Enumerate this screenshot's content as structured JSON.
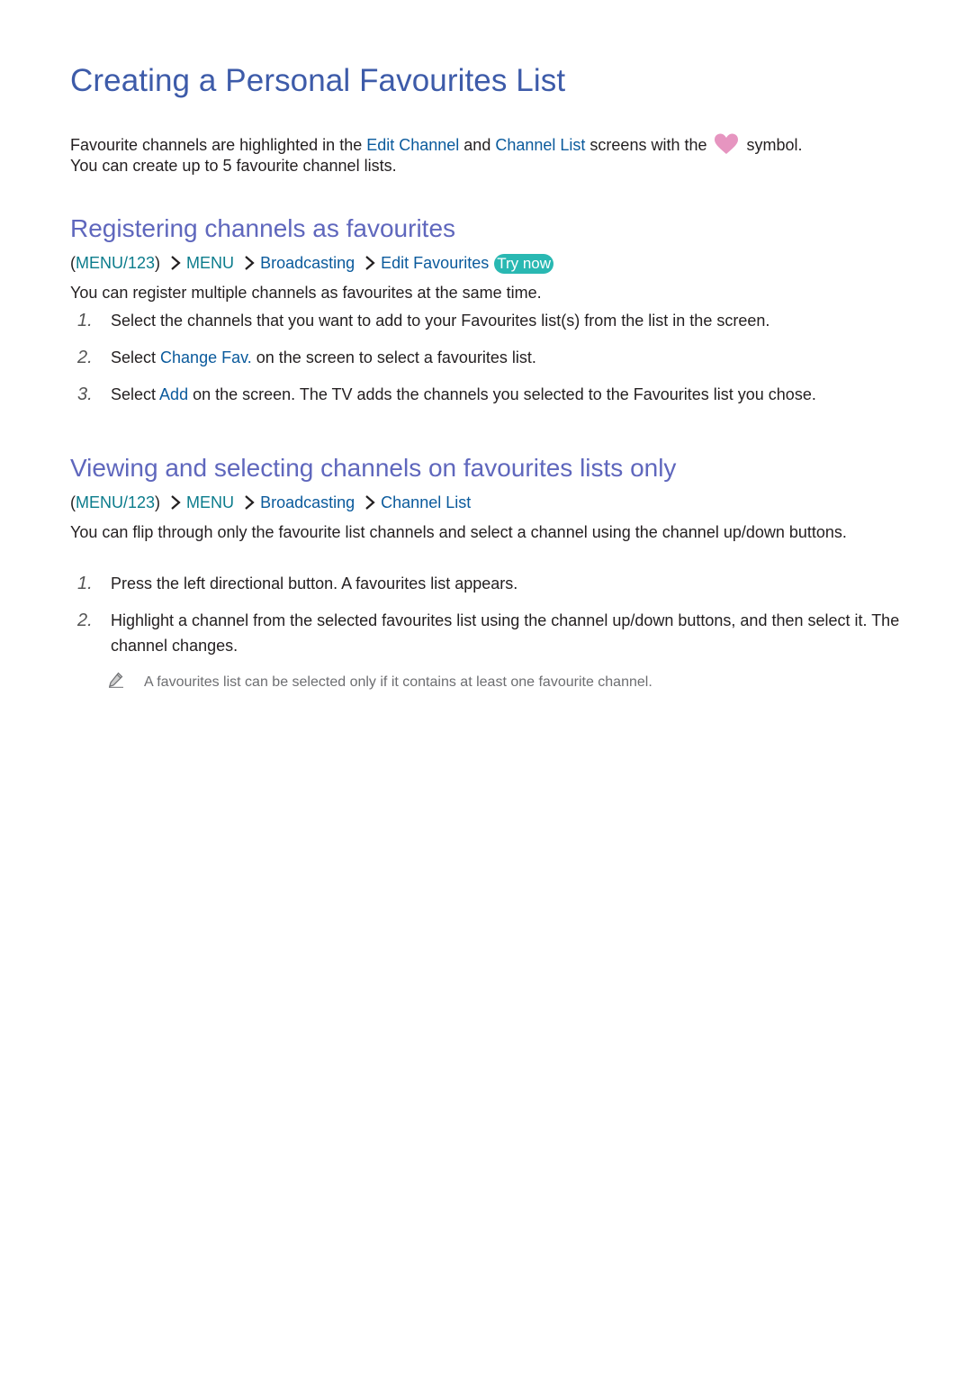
{
  "title": "Creating a Personal Favourites List",
  "intro": {
    "part1": "Favourite channels are highlighted in the ",
    "link1": "Edit Channel",
    "part2": " and ",
    "link2": "Channel List",
    "part3": " screens with the",
    "part4": "symbol.",
    "line2": "You can create up to 5 favourite channel lists.",
    "heart_icon": "heart-icon",
    "heart_color": "#e695c0"
  },
  "section1": {
    "heading": "Registering channels as favourites",
    "path": {
      "open_paren": "(",
      "menu123": "MENU/123",
      "close_paren": ")",
      "menu": "MENU",
      "broadcasting": "Broadcasting",
      "target": "Edit Favourites",
      "try_now": "Try now"
    },
    "description": "You can register multiple channels as favourites at the same time.",
    "steps": [
      {
        "num": "1.",
        "text": "Select the channels that you want to add to your Favourites list(s) from the list in the screen."
      },
      {
        "num": "2.",
        "pre": "Select ",
        "link": "Change Fav.",
        "post": " on the screen to select a favourites list."
      },
      {
        "num": "3.",
        "pre": "Select ",
        "link": "Add",
        "post": " on the screen. The TV adds the channels you selected to the Favourites list you chose."
      }
    ]
  },
  "section2": {
    "heading": "Viewing and selecting channels on favourites lists only",
    "path": {
      "open_paren": "(",
      "menu123": "MENU/123",
      "close_paren": ")",
      "menu": "MENU",
      "broadcasting": "Broadcasting",
      "target": "Channel List"
    },
    "description": "You can flip through only the favourite list channels and select a channel using the channel up/down buttons.",
    "steps": [
      {
        "num": "1.",
        "text": "Press the left directional button. A favourites list appears."
      },
      {
        "num": "2.",
        "text": "Highlight a channel from the selected favourites list using the channel up/down buttons, and then select it. The channel changes."
      }
    ],
    "note": "A favourites list can be selected only if it contains at least one favourite channel.",
    "note_icon": "pencil-icon"
  },
  "colors": {
    "title": "#3d5ba9",
    "heading": "#5f67bd",
    "link": "#0a5a9c",
    "path_teal": "#0b7c8c",
    "try_now_bg": "#29b8b2",
    "body_text": "#231f20",
    "note_text": "#6d6e71"
  }
}
